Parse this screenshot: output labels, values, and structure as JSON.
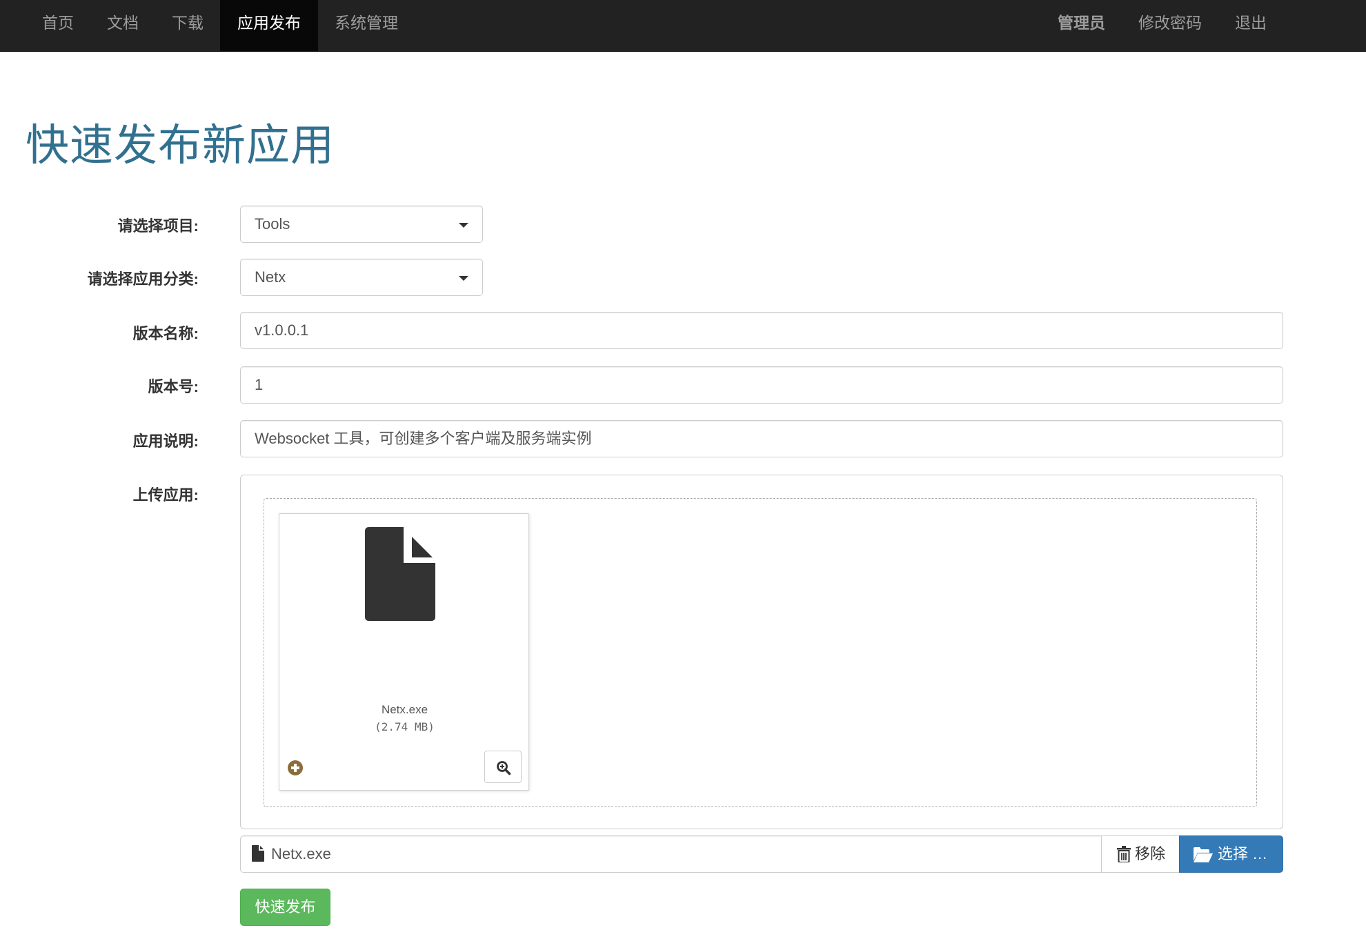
{
  "nav": {
    "left": [
      "首页",
      "文档",
      "下载",
      "应用发布",
      "系统管理"
    ],
    "active_index": 3,
    "right": {
      "user": "管理员",
      "change_password": "修改密码",
      "logout": "退出"
    }
  },
  "page": {
    "title": "快速发布新应用"
  },
  "form": {
    "project": {
      "label": "请选择项目:",
      "value": "Tools"
    },
    "category": {
      "label": "请选择应用分类:",
      "value": "Netx"
    },
    "version_name": {
      "label": "版本名称:",
      "value": "v1.0.0.1"
    },
    "version_code": {
      "label": "版本号:",
      "value": "1"
    },
    "description": {
      "label": "应用说明:",
      "value": "Websocket 工具，可创建多个客户端及服务端实例"
    },
    "upload": {
      "label": "上传应用:",
      "file_name": "Netx.exe",
      "file_size": "(2.74 MB)",
      "input_value": "Netx.exe",
      "remove_label": "移除",
      "choose_label": "选择 …"
    },
    "submit_label": "快速发布"
  },
  "colors": {
    "navbar_bg": "#222222",
    "title": "#31708f",
    "primary": "#337ab7",
    "success": "#5cb85c",
    "upload_indicator": "#8a6d3b"
  },
  "icons": [
    "file-icon",
    "plus-circle-icon",
    "zoom-in-icon",
    "trash-icon",
    "folder-open-icon"
  ]
}
